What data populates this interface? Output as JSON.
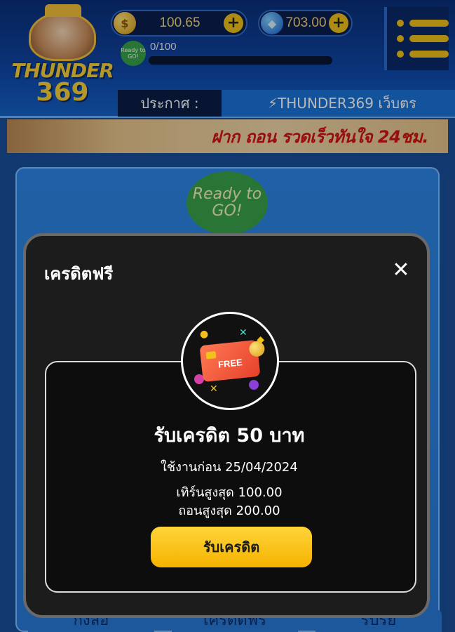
{
  "header": {
    "logo_line1": "THUNDER",
    "logo_line2": "369",
    "coin_balance": "100.65",
    "gem_balance": "703.00",
    "add_symbol": "+",
    "ready_badge": "Ready to GO!",
    "progress_text": "0/100",
    "progress_fraction": 0
  },
  "announcement": {
    "label": "ประกาศ :",
    "text": "⚡THUNDER369 เว็บตร"
  },
  "promo_banner": {
    "text": "ฝาก ถอน รวดเร็วทันใจ 24ชม."
  },
  "background_panel": {
    "ready_text": "Ready to GO!"
  },
  "bottom_tabs": [
    "กงลอ",
    "เครดตฟร",
    "รบรย"
  ],
  "modal": {
    "title": "เครดิตฟรี",
    "close_symbol": "✕",
    "free_card_label": "FREE",
    "reward_title": "รับเครดิต 50 บาท",
    "expire_line": "ใช้งานก่อน 25/04/2024",
    "turnover_line": "เทิร์นสูงสุด 100.00",
    "withdraw_line": "ถอนสูงสุด 200.00",
    "claim_button": "รับเครดิต"
  },
  "colors": {
    "accent_yellow": "#f2c21b",
    "modal_background": "#1c1c1c",
    "header_blue": "#0f47a8"
  }
}
